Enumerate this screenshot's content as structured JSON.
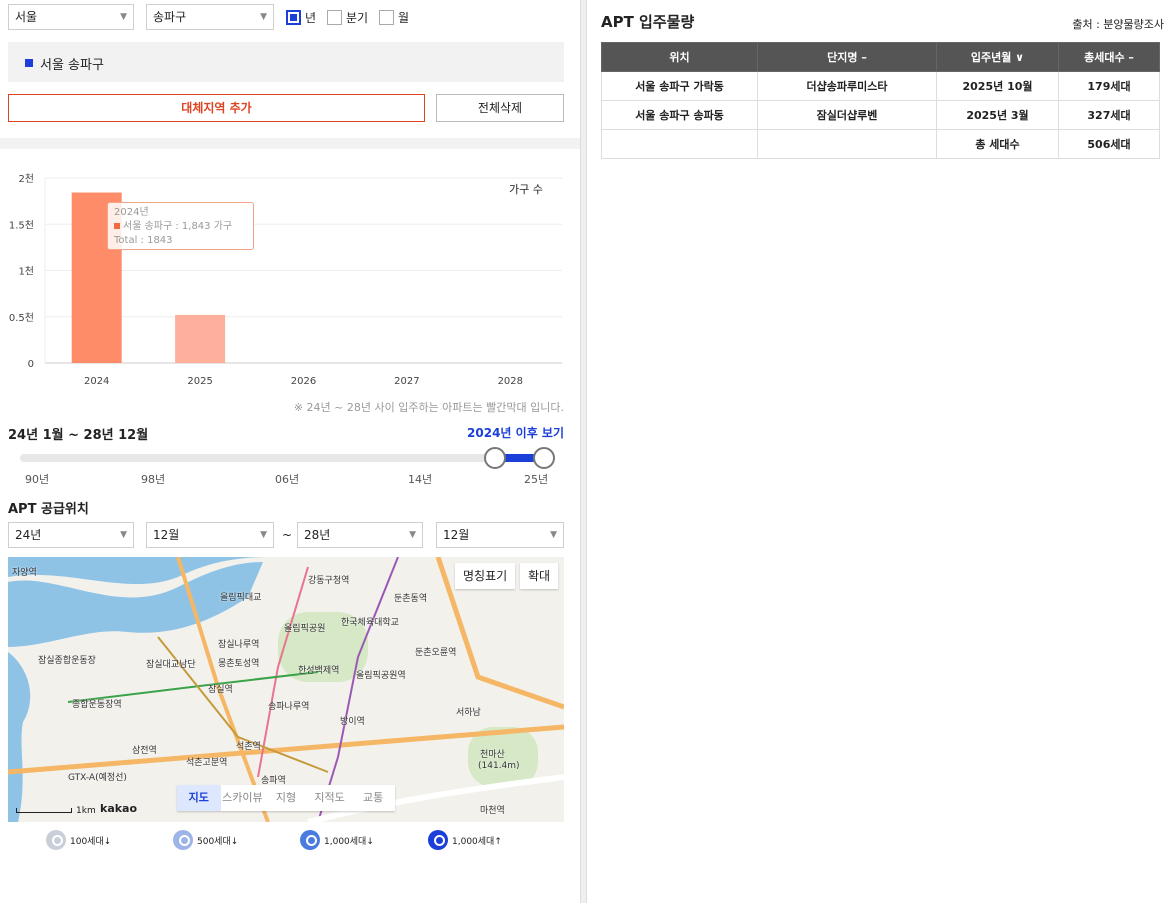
{
  "filters": {
    "city": "서울",
    "district": "송파구",
    "periods": [
      {
        "label": "년",
        "checked": true
      },
      {
        "label": "분기",
        "checked": false
      },
      {
        "label": "월",
        "checked": false
      }
    ]
  },
  "region_label": "서울 송파구",
  "buttons": {
    "add_region": "대체지역 추가",
    "clear_all": "전체삭제"
  },
  "chart_data": {
    "type": "bar",
    "categories": [
      "2024",
      "2025",
      "2026",
      "2027",
      "2028"
    ],
    "values": [
      1843,
      520,
      0,
      0,
      0
    ],
    "ylim": [
      0,
      2000
    ],
    "yticks": [
      "0",
      "0.5천",
      "1천",
      "1.5천",
      "2천"
    ],
    "series": [
      {
        "name": "가구 수",
        "values": [
          1843,
          520,
          0,
          0,
          0
        ]
      }
    ],
    "colors": [
      "#ff8c69",
      "#ffb09c"
    ],
    "grid": true,
    "legend": "top-right",
    "tooltip": {
      "year": "2024년",
      "line": "서울 송파구 : 1,843 가구",
      "total": "Total : 1843"
    }
  },
  "chart_note": "※ 24년 ~ 28년 사이 입주하는 아파트는 빨간막대 입니다.",
  "range": {
    "label": "24년 1월 ~ 28년 12월",
    "after_link": "2024년 이후 보기",
    "ticks": [
      "90년",
      "98년",
      "06년",
      "14년",
      "25년"
    ],
    "selected_fraction": [
      0.907,
      1.0
    ]
  },
  "supply": {
    "title": "APT 공급위치",
    "from_year": "24년",
    "from_month": "12월",
    "tilde": "~",
    "to_year": "28년",
    "to_month": "12월"
  },
  "map": {
    "buttons": [
      "명칭표기",
      "확대"
    ],
    "tabs": [
      "지도",
      "스카이뷰",
      "지형",
      "지적도",
      "교통"
    ],
    "active_tab": "지도",
    "scale": "1km",
    "brand": "kakao",
    "labels": [
      "자양역",
      "강동구청역",
      "올림픽대교",
      "둔촌동역",
      "올림픽공원",
      "한국체육대학교",
      "잠실나루역",
      "둔촌오륜역",
      "잠실대교남단",
      "몽촌토성역",
      "한성백제역",
      "올림픽공원역",
      "잠실종합운동장",
      "종합운동장역",
      "잠실역",
      "송파나루역",
      "방이역",
      "서하남",
      "삼전역",
      "석촌역",
      "석촌고분역",
      "송파역",
      "천마산",
      "(141.4m)",
      "마천역",
      "GTX-A(예정선)"
    ]
  },
  "pin_legend": [
    {
      "label": "100세대↓",
      "color": "#c9cfd8"
    },
    {
      "label": "500세대↓",
      "color": "#9db4e8"
    },
    {
      "label": "1,000세대↓",
      "color": "#4a7be0"
    },
    {
      "label": "1,000세대↑",
      "color": "#1b3fd8"
    }
  ],
  "right": {
    "title": "APT 입주물량",
    "source": "출처 : 분양물량조사",
    "headers": [
      "위치",
      "단지명 –",
      "입주년월 ∨",
      "총세대수 –"
    ],
    "rows": [
      [
        "서울 송파구 가락동",
        "더샵송파루미스타",
        "2025년 10월",
        "179세대"
      ],
      [
        "서울 송파구 송파동",
        "잠실더샵루벤",
        "2025년 3월",
        "327세대"
      ],
      [
        "",
        "",
        "총 세대수",
        "506세대"
      ]
    ]
  }
}
